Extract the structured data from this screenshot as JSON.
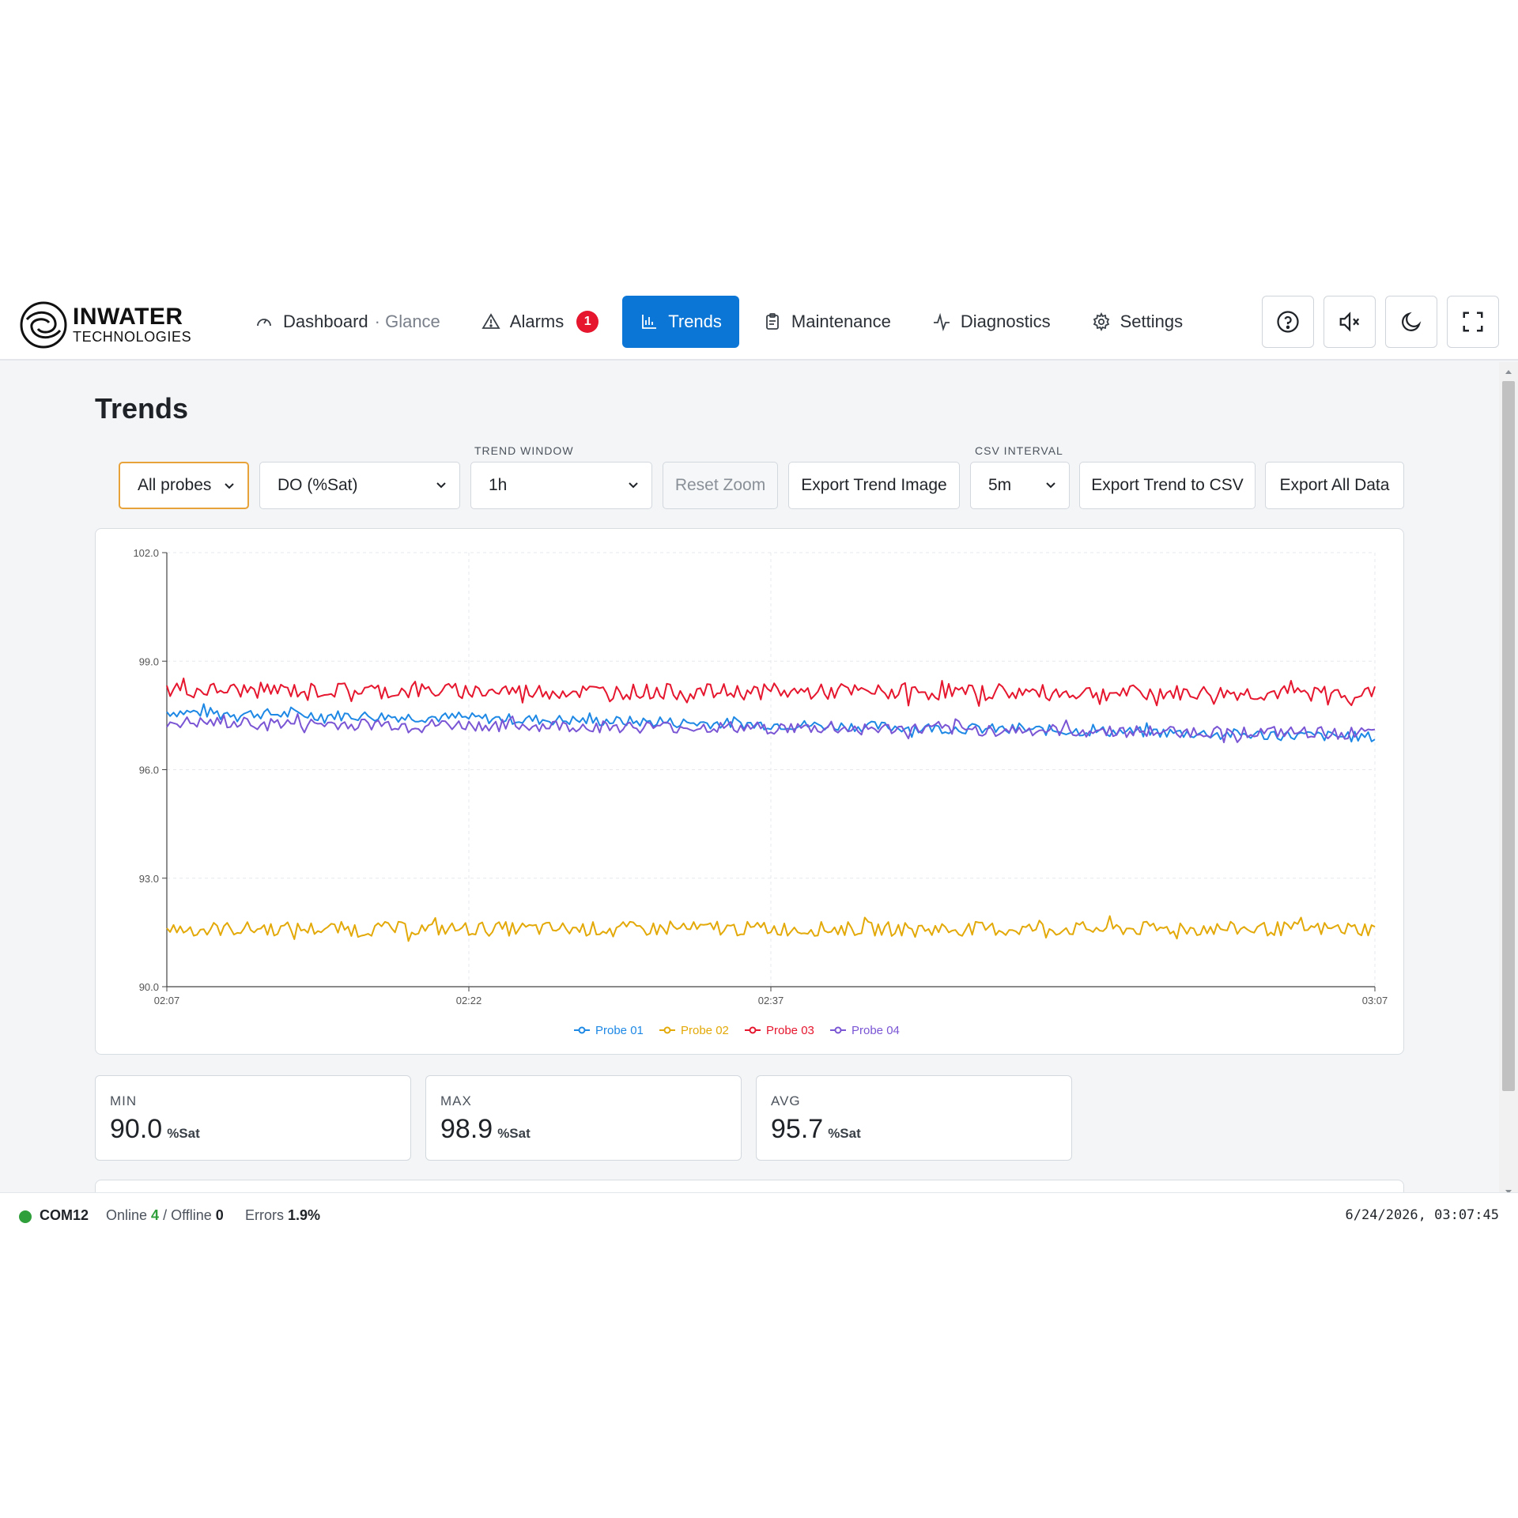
{
  "brand": {
    "name": "INWATER",
    "sub": "TECHNOLOGIES"
  },
  "nav": {
    "dashboard": "Dashboard",
    "dashboard_mode": "· Glance",
    "alarms": "Alarms",
    "alarms_count": "1",
    "trends": "Trends",
    "maintenance": "Maintenance",
    "diagnostics": "Diagnostics",
    "settings": "Settings"
  },
  "header_buttons": [
    "help-icon",
    "speaker-muted-icon",
    "moon-icon",
    "fullscreen-icon"
  ],
  "page": {
    "title": "Trends"
  },
  "controls": {
    "probe_select": "All probes",
    "metric_select": "DO (%Sat)",
    "trend_window_label": "TREND WINDOW",
    "trend_window": "1h",
    "reset_zoom": "Reset Zoom",
    "export_image": "Export Trend Image",
    "csv_interval_label": "CSV INTERVAL",
    "csv_interval": "5m",
    "export_csv": "Export Trend to CSV",
    "export_all": "Export All Data"
  },
  "chart_data": {
    "type": "line",
    "title": "",
    "xlabel": "",
    "ylabel": "",
    "x_ticks": [
      "02:07",
      "02:22",
      "02:37",
      "03:07"
    ],
    "x_tick_minutes": [
      0,
      15,
      30,
      60
    ],
    "xlim_minutes": [
      0,
      60
    ],
    "ylim": [
      90.0,
      102.0
    ],
    "y_ticks": [
      "90.0",
      "93.0",
      "96.0",
      "99.0",
      "102.0"
    ],
    "grid": true,
    "legend": "bottom",
    "series": [
      {
        "name": "Probe 01",
        "color": "#1e88e5",
        "start": 97.6,
        "end": 96.9,
        "noise": 0.15
      },
      {
        "name": "Probe 02",
        "color": "#e3a908",
        "start": 91.6,
        "end": 91.6,
        "noise": 0.2
      },
      {
        "name": "Probe 03",
        "color": "#e5162e",
        "start": 98.2,
        "end": 98.1,
        "noise": 0.22
      },
      {
        "name": "Probe 04",
        "color": "#7a55d4",
        "start": 97.3,
        "end": 97.0,
        "noise": 0.17
      }
    ]
  },
  "stats": {
    "min_label": "MIN",
    "min_value": "90.0",
    "min_unit": "%Sat",
    "max_label": "MAX",
    "max_value": "98.9",
    "max_unit": "%Sat",
    "avg_label": "AVG",
    "avg_value": "95.7",
    "avg_unit": "%Sat"
  },
  "status": {
    "port": "COM12",
    "online_label": "Online",
    "online_count": "4",
    "offline_label": "/ Offline",
    "offline_count": "0",
    "errors_label": "Errors",
    "errors_value": "1.9%",
    "clock": "6/24/2026, 03:07:45"
  }
}
